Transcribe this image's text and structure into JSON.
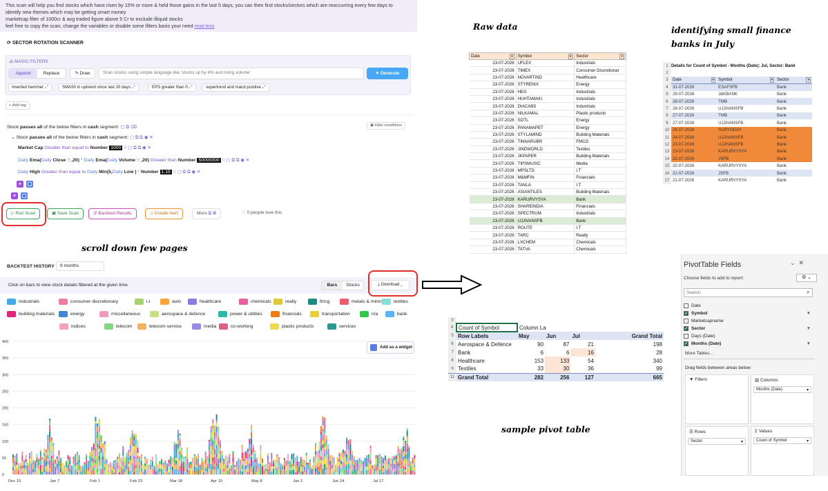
{
  "desc": {
    "lines": [
      "This scan will help you find stocks which have risen by 15% or more & held those gains in the last 5 days, you can then find stocks/sectors which are reoccurring every few days to",
      "identify new themes which may be getting smart money",
      "marketcap filter of 1000cr & avg traded figure above 5 Cr  to exclude illiquid stocks",
      "feel free to copy the scan, change the variables or disable some filters basis your need "
    ],
    "read_less": "read less"
  },
  "scanner": {
    "title": "SECTOR ROTATION SCANNER",
    "magic": "MAGIC FILTERS",
    "append": "Append",
    "replace": "Replace",
    "draw": "Draw",
    "placeholder": "Scan stocks using simple language like 'stocks up by 4% and rising volume'",
    "generate": "Generate",
    "chips": [
      "Inverted hammer",
      "SMA50 in uptrend since last 20 days",
      "EPS greater than 0",
      "supertrend and macd positive"
    ],
    "add_tag": "Add tag",
    "rule1": {
      "a": "Stock ",
      "b": "passes all",
      "c": " of the below filters in ",
      "d": "cash",
      "e": " segment:"
    },
    "hide": "Hide conditions",
    "rule2": {
      "a": "Stock ",
      "b": "passes all",
      "c": " of the below filters in ",
      "d": "cash",
      "e": " segment:"
    },
    "f1": {
      "a": "Market Cap",
      "b": "Greater than equal to",
      "c": "Number",
      "d": "1000"
    },
    "f2": {
      "a": "Daily",
      "b": "Ema(",
      "c": "Daily",
      "d": "Close",
      "e": ",20)",
      "f": "*",
      "g": "Daily",
      "h": "Ema(",
      "i": "Daily",
      "j": "Volume",
      "k": ",20)",
      "l": "Greater than",
      "m": "Number",
      "n": "50000000"
    },
    "f3": {
      "a": "Daily",
      "b": "High",
      "c": "Greater than equal to",
      "d": "Daily",
      "e": "Min(",
      "f": "5,",
      "g": "Daily",
      "h": "Low",
      "i": ")",
      "j": "*",
      "k": "Number",
      "l": "1.15"
    },
    "run": "Run Scan",
    "save": "Save Scan",
    "backtest": "Backtest Results",
    "alert": "Create Alert",
    "more": "More",
    "love": "0 people love this"
  },
  "notes": {
    "scroll": "scroll down few pages",
    "raw": "Raw data",
    "ident": "identifying small finance banks in July",
    "pivot": "sample pivot table"
  },
  "backtest": {
    "title": "BACKTEST HISTORY",
    "period": "9 months",
    "hint": "Click on bars to view stock details filtered at the given time",
    "bars": "Bars",
    "stocks": "Stocks",
    "download": "Download",
    "add_widget": "Add as a widget",
    "legend": [
      {
        "label": "industrials",
        "color": "#49a8e8"
      },
      {
        "label": "consumer discretionary",
        "color": "#f07aa5"
      },
      {
        "label": "i.t",
        "color": "#a8d36a"
      },
      {
        "label": "auto",
        "color": "#f5a53a"
      },
      {
        "label": "healthcare",
        "color": "#8a7be0"
      },
      {
        "label": "chemicals",
        "color": "#e8609f"
      },
      {
        "label": "realty",
        "color": "#e0c83a"
      },
      {
        "label": "fmcg",
        "color": "#1f8a80"
      },
      {
        "label": "metals & mining",
        "color": "#e86070"
      },
      {
        "label": "textiles",
        "color": "#86e0d8"
      },
      {
        "label": "building materials",
        "color": "#e0257a"
      },
      {
        "label": "energy",
        "color": "#3d88d6"
      },
      {
        "label": "miscellaneous",
        "color": "#f09ac0"
      },
      {
        "label": "aerospace & defence",
        "color": "#c8e080"
      },
      {
        "label": "power & utilities",
        "color": "#2fb8a8"
      },
      {
        "label": "financials",
        "color": "#f07a1a"
      },
      {
        "label": "transportation",
        "color": "#e8d030"
      },
      {
        "label": "n/a",
        "color": "#30c84a"
      },
      {
        "label": "bank",
        "color": "#5ab4f0"
      },
      {
        "label": "indices",
        "color": "#f5a0c0"
      },
      {
        "label": "telecom",
        "color": "#80d880"
      },
      {
        "label": "telecom-service",
        "color": "#f5b060"
      },
      {
        "label": "media",
        "color": "#9a8ae8"
      },
      {
        "label": "co-working",
        "color": "#e06080"
      },
      {
        "label": "plastic products",
        "color": "#f0d850"
      },
      {
        "label": "services",
        "color": "#2f9890"
      }
    ],
    "yticks": [
      "400",
      "350",
      "300",
      "250",
      "200",
      "150",
      "100",
      "50",
      "0"
    ],
    "xticks": [
      "Dec 15",
      "Jan 7",
      "Feb 1",
      "Feb 23",
      "Mar 18",
      "Apr 15",
      "May 8",
      "Jun 2",
      "Jun 24",
      "Jul 17"
    ]
  },
  "raw": {
    "headers": [
      "Date",
      "Symbol",
      "Sector"
    ],
    "rows": [
      [
        "23-07-2026",
        "UFLEX",
        "Industrials"
      ],
      [
        "23-07-2026",
        "TIMEX",
        "Consumer Discretionar"
      ],
      [
        "23-07-2026",
        "NOVARTIND",
        "Healthcare"
      ],
      [
        "23-07-2026",
        "STYRENIX",
        "Energy"
      ],
      [
        "23-07-2026",
        "HEG",
        "Industrials"
      ],
      [
        "23-07-2026",
        "HUHTAMAKI",
        "Industrials"
      ],
      [
        "23-07-2026",
        "DIACABS",
        "Industrials"
      ],
      [
        "23-07-2026",
        "NILKAMAL",
        "Plastic products"
      ],
      [
        "23-07-2026",
        "SOTL",
        "Energy"
      ],
      [
        "23-07-2026",
        "PANAMAPET",
        "Energy"
      ],
      [
        "23-07-2026",
        "STYLAMIND",
        "Building Materials"
      ],
      [
        "23-07-2026",
        "TINNARUBR",
        "FMCG"
      ],
      [
        "23-07-2026",
        "JINDWORLD",
        "Textiles"
      ],
      [
        "23-07-2026",
        "JKPAPER",
        "Building Materials"
      ],
      [
        "23-07-2026",
        "TIPSMUSIC",
        "Media"
      ],
      [
        "23-07-2026",
        "MPSLTD",
        "I.T"
      ],
      [
        "23-07-2026",
        "M&MFIN",
        "Financials"
      ],
      [
        "23-07-2026",
        "TANLA",
        "I.T"
      ],
      [
        "23-07-2026",
        "ASIANTILES",
        "Building Materials"
      ],
      [
        "23-07-2026",
        "KARURVYSYA",
        "Bank"
      ],
      [
        "23-07-2026",
        "SHAREINDIA",
        "Financials"
      ],
      [
        "23-07-2026",
        "SPECTRUM",
        "Industrials"
      ],
      [
        "23-07-2026",
        "UJJIVANSFB",
        "Bank"
      ],
      [
        "23-07-2026",
        "ROUTE",
        "I.T"
      ],
      [
        "23-07-2026",
        "TARC",
        "Realty"
      ],
      [
        "23-07-2026",
        "LXCHEM",
        "Chemicals"
      ],
      [
        "23-07-2026",
        "TATVA",
        "Chemicals"
      ]
    ]
  },
  "details": {
    "title": "Details for Count of Symbol - Months (Date): Jul, Sector: Bank",
    "headers": [
      "Date",
      "Symbol",
      "Sector"
    ],
    "rows": [
      [
        "31-07-2026",
        "ESAFSFB",
        "Bank"
      ],
      [
        "29-07-2026",
        "J&KBANK",
        "Bank"
      ],
      [
        "28-07-2026",
        "TMB",
        "Bank"
      ],
      [
        "28-07-2026",
        "UJJIVANSFB",
        "Bank"
      ],
      [
        "27-07-2026",
        "TMB",
        "Bank"
      ],
      [
        "27-07-2026",
        "UJJIVANSFB",
        "Bank"
      ],
      [
        "24-07-2026",
        "SURYODAY",
        "Bank"
      ],
      [
        "24-07-2026",
        "UJJIVANSFB",
        "Bank"
      ],
      [
        "23-07-2026",
        "UJJIVANSFB",
        "Bank"
      ],
      [
        "23-07-2026",
        "KARURVYSYA",
        "Bank"
      ],
      [
        "22-07-2026",
        "JSFB",
        "Bank"
      ],
      [
        "22-07-2026",
        "KARURVYSYA",
        "Bank"
      ],
      [
        "21-07-2026",
        "JSFB",
        "Bank"
      ],
      [
        "21-07-2026",
        "KARURVYSYA",
        "Bank"
      ]
    ],
    "rownums": [
      "1",
      "2",
      "3",
      "4",
      "5",
      "6",
      "7",
      "8",
      "9",
      "10",
      "11",
      "12",
      "13",
      "14",
      "15",
      "16",
      "17"
    ]
  },
  "pivot": {
    "rownums": [
      "3",
      "4",
      "5",
      "6",
      "7",
      "8",
      "9",
      "10",
      "11"
    ],
    "h1": "Count of Symbol",
    "h2": "Column La",
    "cols": [
      "Row Labels",
      "May",
      "Jun",
      "Jul",
      "Grand Total"
    ],
    "rows": [
      [
        "Aerospace & Defence",
        "90",
        "87",
        "21",
        "198"
      ],
      [
        "Bank",
        "6",
        "6",
        "16",
        "28"
      ],
      [
        "Healthcare",
        "153",
        "133",
        "54",
        "340"
      ],
      [
        "Textiles",
        "33",
        "30",
        "36",
        "99"
      ]
    ],
    "total": [
      "Grand Total",
      "282",
      "256",
      "127",
      "665"
    ]
  },
  "pane": {
    "title": "PivotTable Fields",
    "choose": "Choose fields to add to report:",
    "search": "Search",
    "fields": [
      {
        "n": "Date",
        "c": false,
        "b": false
      },
      {
        "n": "Symbol",
        "c": true,
        "b": true
      },
      {
        "n": "Marketcapname",
        "c": false,
        "b": false
      },
      {
        "n": "Sector",
        "c": true,
        "b": true
      },
      {
        "n": "Days (Date)",
        "c": false,
        "b": false
      },
      {
        "n": "Months (Date)",
        "c": true,
        "b": true
      }
    ],
    "more": "More Tables...",
    "drag": "Drag fields between areas below:",
    "filters": "Filters",
    "columns": "Columns",
    "columns_val": "Months (Date)",
    "rows": "Rows",
    "rows_val": "Sector",
    "values": "Values",
    "values_val": "Count of Symbol"
  }
}
